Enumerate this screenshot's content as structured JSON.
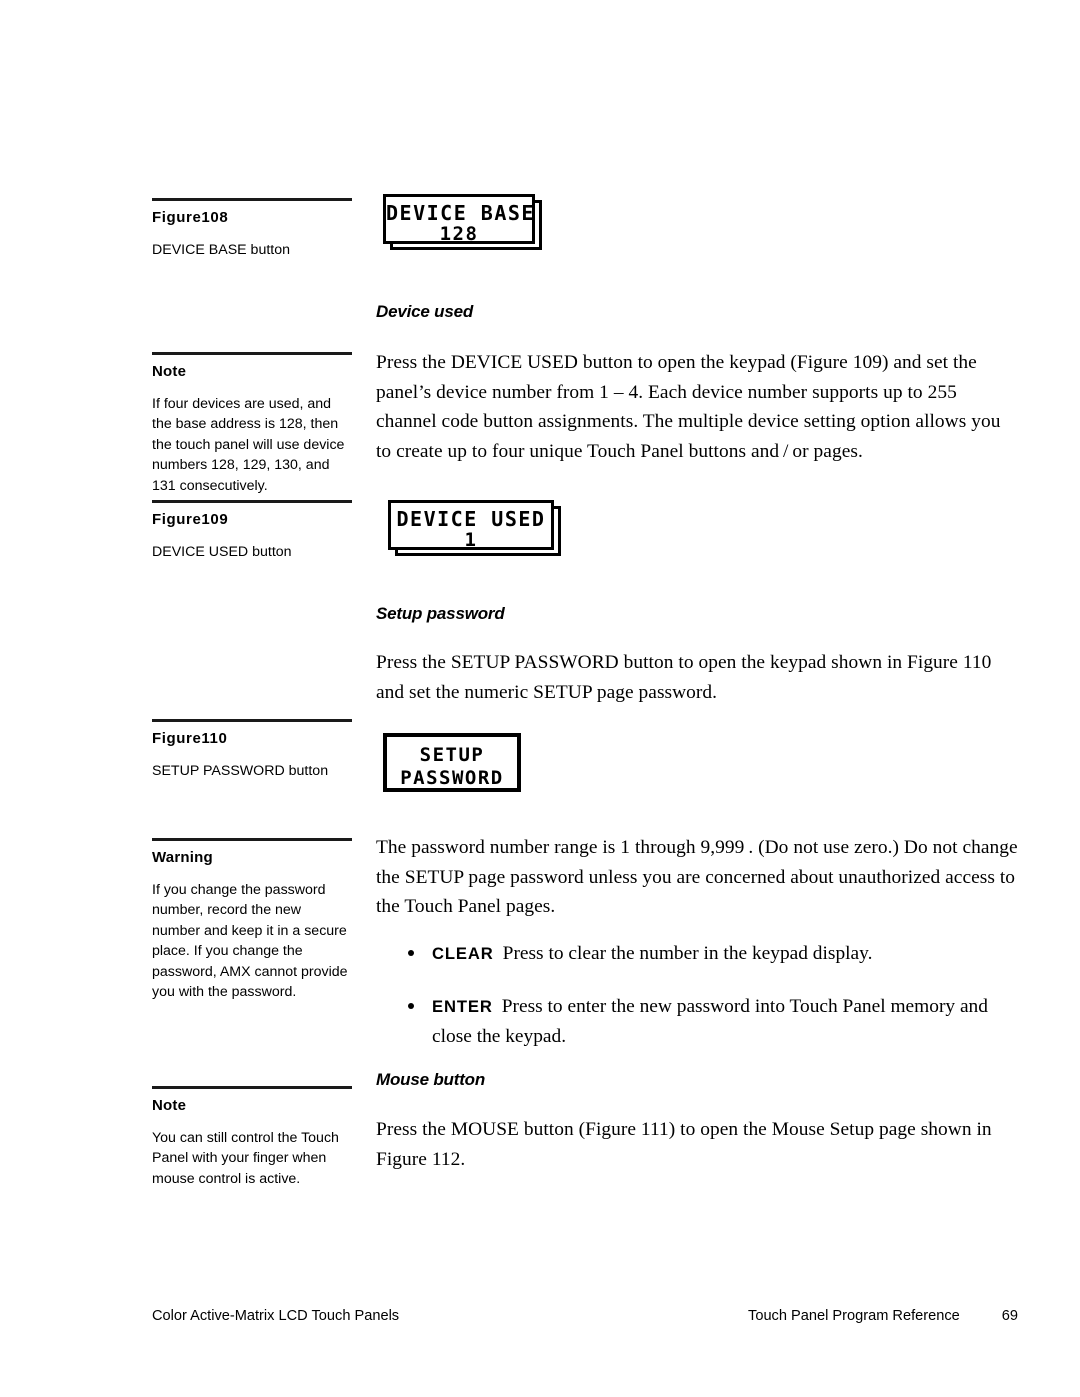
{
  "page": {
    "footer": {
      "left": "Color Active-Matrix LCD Touch Panels",
      "right_title": "Touch Panel Program Reference",
      "page_number": "69"
    }
  },
  "sidebar": [
    {
      "id": "figure-108",
      "heading": "Figure108",
      "body": "DEVICE BASE button"
    },
    {
      "id": "note-device-numbers",
      "heading": "Note",
      "body": "If four devices are used, and the base address is 128, then the touch panel will use device numbers 128, 129, 130, and 131 consecutively."
    },
    {
      "id": "figure-109",
      "heading": "Figure109",
      "body": "DEVICE USED button"
    },
    {
      "id": "figure-110",
      "heading": "Figure110",
      "body": "SETUP PASSWORD button"
    },
    {
      "id": "warning-password",
      "heading": "Warning",
      "body": "If you change the password number, record the new number and keep it in a secure place. If you change the password, AMX cannot provide you with the password."
    },
    {
      "id": "note-mouse",
      "heading": "Note",
      "body": "You can still control the Touch Panel with your finger when mouse control is active."
    }
  ],
  "buttons": {
    "device_base": {
      "line1": "DEVICE BASE",
      "line2": "128"
    },
    "device_used": {
      "line1": "DEVICE USED",
      "line2": "1"
    },
    "setup_password": {
      "line1": "SETUP",
      "line2": "PASSWORD"
    }
  },
  "sections": {
    "device_used": {
      "heading": "Device used",
      "paragraph": "Press the DEVICE USED button to open the keypad (Figure 109) and set the panel’s device number from 1 – 4. Each device number supports up to 255 channel code button assignments. The multiple device setting option allows you to create up to four unique Touch Panel buttons and / or pages."
    },
    "setup_password": {
      "heading": "Setup password",
      "paragraph": "Press the SETUP PASSWORD button to open the keypad shown in Figure 110 and set the numeric SETUP page password.",
      "paragraph2": "The password number range is 1 through 9,999 . (Do not use zero.) Do not change the SETUP page password unless you are concerned about unauthorized access to the Touch Panel pages.",
      "bullets": [
        {
          "keyword": "CLEAR",
          "text": "Press to clear the number in the keypad display."
        },
        {
          "keyword": "ENTER",
          "text": "Press to enter the new password into Touch Panel memory and close the keypad."
        }
      ]
    },
    "mouse_button": {
      "heading": "Mouse button",
      "paragraph": "Press the MOUSE button (Figure 111) to open the Mouse Setup page shown in Figure 112."
    }
  }
}
